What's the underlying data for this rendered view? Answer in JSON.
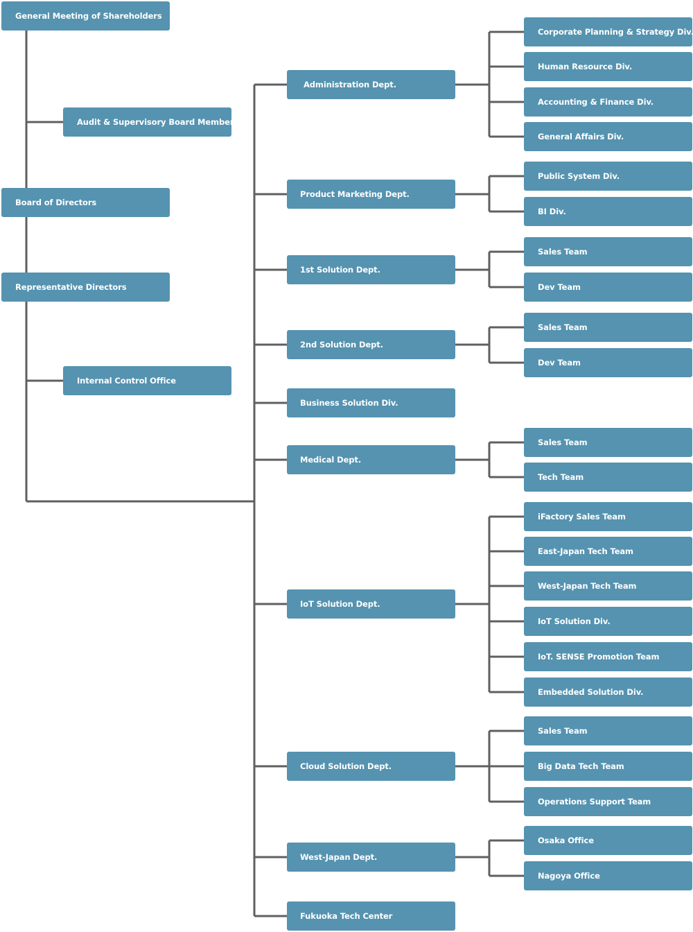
{
  "colors": {
    "box": "#5593b0",
    "line": "#5f5f5f",
    "text": "#ffffff"
  },
  "left": {
    "shareholders": "General Meeting of Shareholders",
    "audit": "Audit & Supervisory Board Member",
    "board": "Board of Directors",
    "representative": "Representative Directors",
    "internal_control": "Internal Control Office"
  },
  "departments": [
    {
      "label": "Administration Dept.",
      "units": [
        "Corporate Planning & Strategy Div.",
        "Human Resource Div.",
        "Accounting & Finance Div.",
        "General Affairs Div."
      ]
    },
    {
      "label": "Product Marketing Dept.",
      "units": [
        "Public System Div.",
        "BI Div."
      ]
    },
    {
      "label": "1st Solution Dept.",
      "units": [
        "Sales Team",
        "Dev Team"
      ]
    },
    {
      "label": "2nd Solution Dept.",
      "units": [
        "Sales Team",
        "Dev Team"
      ]
    },
    {
      "label": "Business Solution Div.",
      "units": []
    },
    {
      "label": "Medical Dept.",
      "units": [
        "Sales Team",
        "Tech Team"
      ]
    },
    {
      "label": "IoT Solution Dept.",
      "units": [
        "iFactory Sales Team",
        "East-Japan Tech Team",
        "West-Japan Tech Team",
        "IoT Solution Div.",
        "IoT. SENSE Promotion Team",
        "Embedded Solution Div."
      ]
    },
    {
      "label": "Cloud Solution Dept.",
      "units": [
        "Sales Team",
        "Big Data Tech Team",
        "Operations Support Team"
      ]
    },
    {
      "label": "West-Japan Dept.",
      "units": [
        "Osaka Office",
        "Nagoya Office"
      ]
    },
    {
      "label": "Fukuoka Tech Center",
      "units": []
    }
  ]
}
